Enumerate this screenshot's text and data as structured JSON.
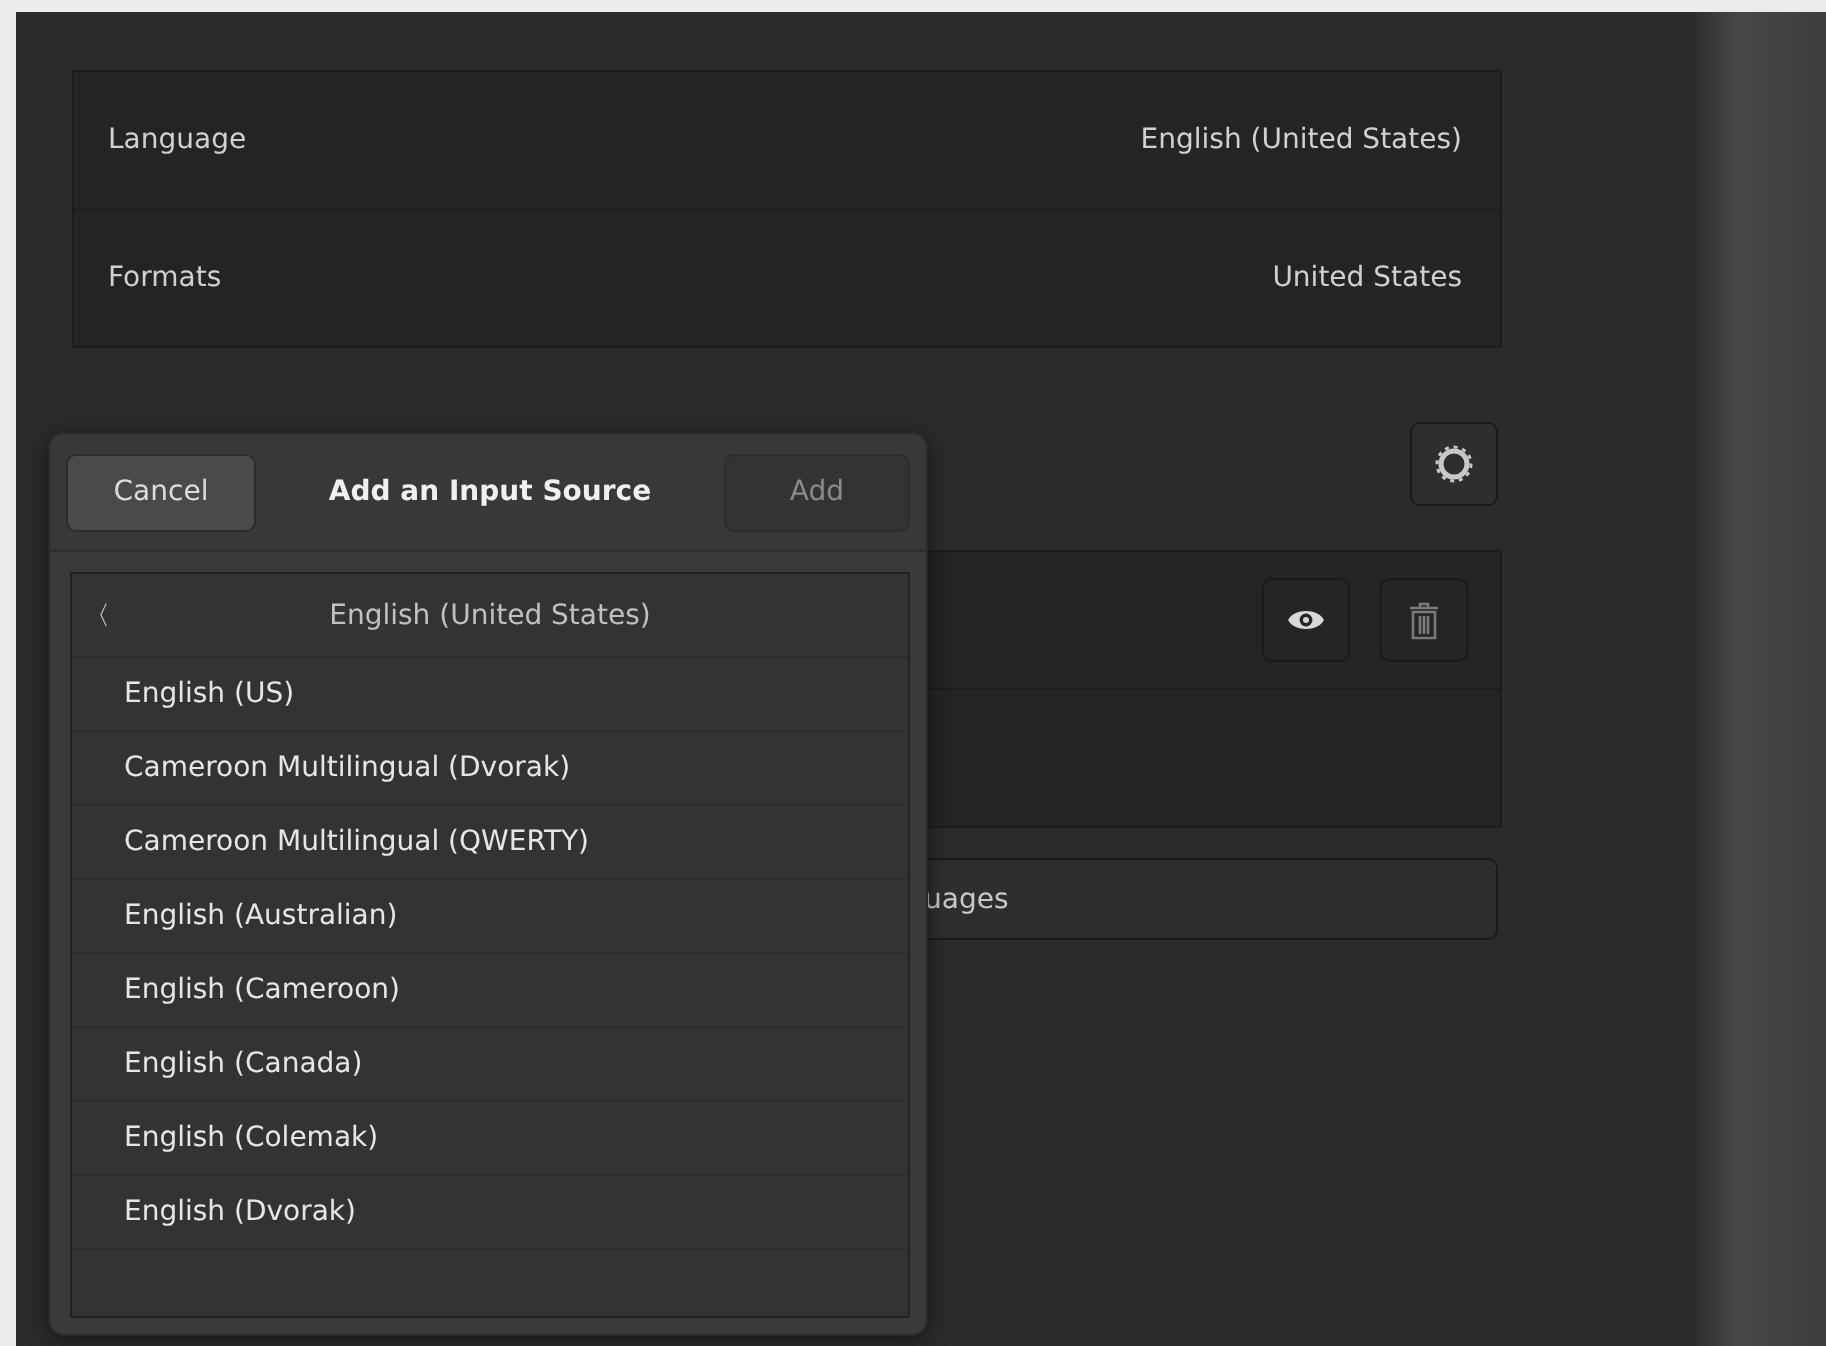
{
  "region": {
    "rows": [
      {
        "label": "Language",
        "value": "English (United States)"
      },
      {
        "label": "Formats",
        "value": "United States"
      }
    ]
  },
  "input_sources": {
    "rows": [
      {
        "kind": "source"
      },
      {
        "kind": "empty"
      }
    ],
    "languages_button": "uages"
  },
  "popover": {
    "cancel": "Cancel",
    "title": "Add an Input Source",
    "add": "Add",
    "add_disabled": true,
    "list_header": "English (United States)",
    "back": "〈",
    "items": [
      "English (US)",
      "Cameroon Multilingual (Dvorak)",
      "Cameroon Multilingual (QWERTY)",
      "English (Australian)",
      "English (Cameroon)",
      "English (Canada)",
      "English (Colemak)",
      "English (Dvorak)"
    ]
  }
}
